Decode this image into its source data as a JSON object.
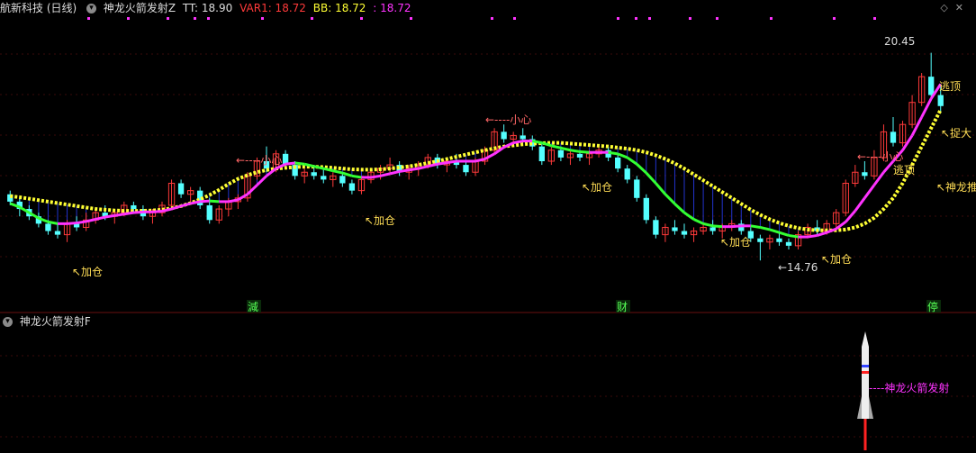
{
  "header": {
    "stock": "航新科技 (日线)",
    "indicator": "神龙火箭发射Z",
    "tt_label": "TT: 18.90",
    "var1_label": "VAR1: 18.72",
    "bb_label": "BB: 18.72",
    "extra_label": ": 18.72",
    "win_up": "◇",
    "win_close": "✕"
  },
  "sub_header": {
    "indicator": "神龙火箭发射F"
  },
  "colors": {
    "up": "#ff3a3a",
    "down": "#54ffff",
    "ma_yellow": "#ffff33",
    "ma_magenta": "#ff33ff",
    "ma_green": "#33ff33",
    "fill_blue": "#2233cc",
    "label_yellow": "#ffdd55",
    "label_red": "#ff6666",
    "white": "#dddddd",
    "grid": "#3a0a0a"
  },
  "markers": [
    "減",
    "财",
    "停"
  ],
  "annotations": {
    "jiacang": "↖加仓",
    "xiaoxin": "←----小心",
    "taoding": "逃顶",
    "zhuoda": "↖捉大",
    "shenlong_up": "↖神龙推",
    "high_price": "20.45",
    "low_price": "←14.76",
    "rocket_label": "----神龙火箭发射"
  },
  "chart_data": {
    "type": "candlestick",
    "title": "航新科技 (日线)",
    "ylim": [
      13.8,
      21.2
    ],
    "candles": [
      [
        16.6,
        16.7,
        16.3,
        16.4
      ],
      [
        16.4,
        16.5,
        16.0,
        16.2
      ],
      [
        16.2,
        16.3,
        15.9,
        16.0
      ],
      [
        16.0,
        16.1,
        15.7,
        15.8
      ],
      [
        15.8,
        15.9,
        15.5,
        15.6
      ],
      [
        15.6,
        15.8,
        15.4,
        15.5
      ],
      [
        15.5,
        15.9,
        15.3,
        15.8
      ],
      [
        15.8,
        16.0,
        15.6,
        15.7
      ],
      [
        15.7,
        16.1,
        15.6,
        15.9
      ],
      [
        15.9,
        16.2,
        15.8,
        16.1
      ],
      [
        16.1,
        16.3,
        15.9,
        16.0
      ],
      [
        16.0,
        16.2,
        15.8,
        16.1
      ],
      [
        16.1,
        16.4,
        16.0,
        16.3
      ],
      [
        16.3,
        16.4,
        16.1,
        16.2
      ],
      [
        16.2,
        16.3,
        15.9,
        16.0
      ],
      [
        16.0,
        16.2,
        15.8,
        16.1
      ],
      [
        16.1,
        16.4,
        16.0,
        16.3
      ],
      [
        16.3,
        17.0,
        16.2,
        16.9
      ],
      [
        16.9,
        17.0,
        16.5,
        16.6
      ],
      [
        16.6,
        16.8,
        16.4,
        16.7
      ],
      [
        16.7,
        16.8,
        16.2,
        16.3
      ],
      [
        16.3,
        16.5,
        15.8,
        15.9
      ],
      [
        15.9,
        16.3,
        15.8,
        16.2
      ],
      [
        16.2,
        16.5,
        16.0,
        16.4
      ],
      [
        16.4,
        16.6,
        16.2,
        16.5
      ],
      [
        16.5,
        17.2,
        16.4,
        17.1
      ],
      [
        17.1,
        17.6,
        17.0,
        17.5
      ],
      [
        17.5,
        17.9,
        17.2,
        17.3
      ],
      [
        17.3,
        17.8,
        17.2,
        17.7
      ],
      [
        17.7,
        17.8,
        17.3,
        17.4
      ],
      [
        17.4,
        17.5,
        17.0,
        17.1
      ],
      [
        17.1,
        17.3,
        16.9,
        17.2
      ],
      [
        17.2,
        17.4,
        17.0,
        17.1
      ],
      [
        17.1,
        17.3,
        16.9,
        17.0
      ],
      [
        17.0,
        17.2,
        16.8,
        17.1
      ],
      [
        17.1,
        17.2,
        16.8,
        16.9
      ],
      [
        16.9,
        17.0,
        16.6,
        16.7
      ],
      [
        16.7,
        17.1,
        16.6,
        17.0
      ],
      [
        17.0,
        17.3,
        16.9,
        17.2
      ],
      [
        17.2,
        17.4,
        17.0,
        17.3
      ],
      [
        17.3,
        17.6,
        17.2,
        17.4
      ],
      [
        17.4,
        17.5,
        17.1,
        17.2
      ],
      [
        17.2,
        17.4,
        17.0,
        17.3
      ],
      [
        17.3,
        17.5,
        17.1,
        17.4
      ],
      [
        17.4,
        17.7,
        17.3,
        17.6
      ],
      [
        17.6,
        17.7,
        17.3,
        17.4
      ],
      [
        17.4,
        17.6,
        17.2,
        17.5
      ],
      [
        17.5,
        17.7,
        17.3,
        17.4
      ],
      [
        17.4,
        17.5,
        17.1,
        17.2
      ],
      [
        17.2,
        17.6,
        17.1,
        17.5
      ],
      [
        17.5,
        17.9,
        17.4,
        17.8
      ],
      [
        17.8,
        18.4,
        17.7,
        18.3
      ],
      [
        18.3,
        18.5,
        18.0,
        18.1
      ],
      [
        18.1,
        18.3,
        17.9,
        18.2
      ],
      [
        18.2,
        18.4,
        18.0,
        18.1
      ],
      [
        18.1,
        18.2,
        17.8,
        17.9
      ],
      [
        17.9,
        18.0,
        17.4,
        17.5
      ],
      [
        17.5,
        17.9,
        17.4,
        17.8
      ],
      [
        17.8,
        17.9,
        17.5,
        17.6
      ],
      [
        17.6,
        17.8,
        17.4,
        17.7
      ],
      [
        17.7,
        17.8,
        17.5,
        17.6
      ],
      [
        17.6,
        17.8,
        17.4,
        17.7
      ],
      [
        17.7,
        17.9,
        17.6,
        17.8
      ],
      [
        17.8,
        17.9,
        17.5,
        17.6
      ],
      [
        17.6,
        17.7,
        17.2,
        17.3
      ],
      [
        17.3,
        17.4,
        16.9,
        17.0
      ],
      [
        17.0,
        17.1,
        16.4,
        16.5
      ],
      [
        16.5,
        16.6,
        15.8,
        15.9
      ],
      [
        15.9,
        16.0,
        15.4,
        15.5
      ],
      [
        15.5,
        15.8,
        15.3,
        15.7
      ],
      [
        15.7,
        15.9,
        15.5,
        15.6
      ],
      [
        15.6,
        15.8,
        15.4,
        15.5
      ],
      [
        15.5,
        15.7,
        15.3,
        15.6
      ],
      [
        15.6,
        15.8,
        15.5,
        15.7
      ],
      [
        15.7,
        15.9,
        15.5,
        15.6
      ],
      [
        15.6,
        15.8,
        15.4,
        15.7
      ],
      [
        15.7,
        15.9,
        15.6,
        15.8
      ],
      [
        15.8,
        15.9,
        15.5,
        15.6
      ],
      [
        15.6,
        15.7,
        15.3,
        15.4
      ],
      [
        15.4,
        15.5,
        14.8,
        15.3
      ],
      [
        15.3,
        15.5,
        15.1,
        15.4
      ],
      [
        15.4,
        15.6,
        15.2,
        15.3
      ],
      [
        15.3,
        15.4,
        15.1,
        15.2
      ],
      [
        15.2,
        15.6,
        15.1,
        15.5
      ],
      [
        15.5,
        15.8,
        15.4,
        15.7
      ],
      [
        15.7,
        15.9,
        15.5,
        15.6
      ],
      [
        15.6,
        15.9,
        15.5,
        15.8
      ],
      [
        15.8,
        16.2,
        15.7,
        16.1
      ],
      [
        16.1,
        17.0,
        16.0,
        16.9
      ],
      [
        16.9,
        17.4,
        16.8,
        17.2
      ],
      [
        17.2,
        17.5,
        17.0,
        17.1
      ],
      [
        17.1,
        17.8,
        17.0,
        17.6
      ],
      [
        17.6,
        18.5,
        17.5,
        18.3
      ],
      [
        18.3,
        18.7,
        17.9,
        18.0
      ],
      [
        18.0,
        18.6,
        17.9,
        18.5
      ],
      [
        18.5,
        19.3,
        18.4,
        19.1
      ],
      [
        19.1,
        19.9,
        19.0,
        19.8
      ],
      [
        19.8,
        20.45,
        19.2,
        19.3
      ],
      [
        19.3,
        19.6,
        18.8,
        19.0
      ]
    ],
    "ma_line": [
      16.35,
      16.25,
      16.1,
      15.95,
      15.85,
      15.8,
      15.8,
      15.82,
      15.86,
      15.92,
      15.98,
      16.02,
      16.06,
      16.1,
      16.12,
      16.12,
      16.14,
      16.2,
      16.28,
      16.35,
      16.4,
      16.42,
      16.4,
      16.4,
      16.45,
      16.6,
      16.85,
      17.1,
      17.3,
      17.42,
      17.45,
      17.42,
      17.36,
      17.3,
      17.24,
      17.18,
      17.1,
      17.06,
      17.06,
      17.1,
      17.16,
      17.22,
      17.26,
      17.3,
      17.36,
      17.42,
      17.46,
      17.5,
      17.5,
      17.5,
      17.56,
      17.7,
      17.88,
      18.0,
      18.05,
      18.05,
      18.0,
      17.92,
      17.86,
      17.8,
      17.76,
      17.74,
      17.74,
      17.74,
      17.7,
      17.6,
      17.42,
      17.18,
      16.9,
      16.6,
      16.34,
      16.1,
      15.92,
      15.8,
      15.74,
      15.72,
      15.72,
      15.74,
      15.74,
      15.7,
      15.64,
      15.56,
      15.48,
      15.44,
      15.44,
      15.48,
      15.56,
      15.66,
      15.85,
      16.15,
      16.5,
      16.85,
      17.2,
      17.5,
      17.8,
      18.2,
      18.7,
      19.2,
      19.6
    ],
    "signal_line": [
      16.55,
      16.52,
      16.48,
      16.44,
      16.4,
      16.36,
      16.32,
      16.28,
      16.24,
      16.2,
      16.18,
      16.16,
      16.15,
      16.15,
      16.15,
      16.16,
      16.18,
      16.22,
      16.28,
      16.36,
      16.46,
      16.58,
      16.72,
      16.88,
      17.02,
      17.12,
      17.2,
      17.26,
      17.3,
      17.32,
      17.34,
      17.35,
      17.35,
      17.34,
      17.32,
      17.3,
      17.28,
      17.27,
      17.27,
      17.28,
      17.3,
      17.33,
      17.36,
      17.4,
      17.45,
      17.5,
      17.56,
      17.62,
      17.68,
      17.74,
      17.8,
      17.85,
      17.9,
      17.93,
      17.96,
      17.98,
      17.99,
      18.0,
      18.0,
      17.98,
      17.96,
      17.94,
      17.92,
      17.9,
      17.87,
      17.84,
      17.8,
      17.74,
      17.66,
      17.56,
      17.44,
      17.3,
      17.14,
      16.98,
      16.82,
      16.66,
      16.5,
      16.34,
      16.18,
      16.04,
      15.92,
      15.82,
      15.74,
      15.68,
      15.64,
      15.62,
      15.62,
      15.62,
      15.64,
      15.7,
      15.8,
      15.96,
      16.2,
      16.5,
      16.9,
      17.4,
      17.9,
      18.4,
      18.9
    ]
  }
}
